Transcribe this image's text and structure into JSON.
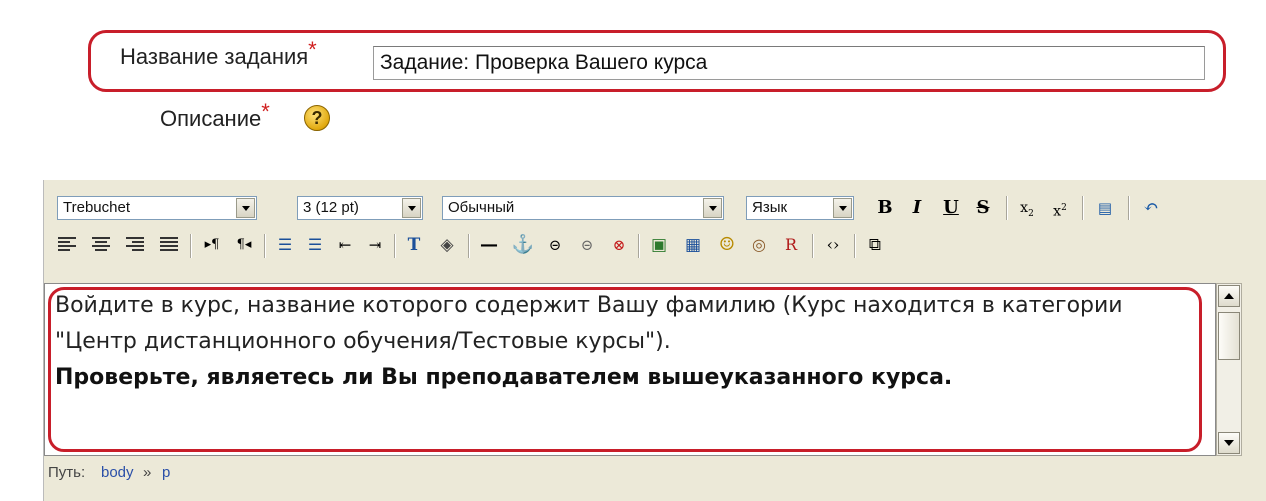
{
  "form": {
    "title_label": "Название задания",
    "title_required": "*",
    "title_value": "Задание: Проверка Вашего курса",
    "description_label": "Описание",
    "description_required": "*",
    "help_glyph": "?"
  },
  "toolbar": {
    "font_family": "Trebuchet",
    "font_size": "3 (12 pt)",
    "format": "Обычный",
    "language": "Язык",
    "row1_icons": [
      "bold-icon",
      "italic-icon",
      "underline-icon",
      "strikethrough-icon",
      "subscript-icon",
      "superscript-icon",
      "paste-word-icon",
      "undo-icon"
    ],
    "row2_icons": [
      "align-left-icon",
      "align-center-icon",
      "align-right-icon",
      "align-justify-icon",
      "ltr-icon",
      "rtl-icon",
      "ordered-list-icon",
      "unordered-list-icon",
      "outdent-icon",
      "indent-icon",
      "text-color-icon",
      "bg-color-icon",
      "horizontal-rule-icon",
      "anchor-icon",
      "link-icon",
      "unlink-icon",
      "nolink-icon",
      "image-icon",
      "table-icon",
      "smiley-icon",
      "special-char-icon",
      "search-replace-icon",
      "html-source-icon",
      "fullscreen-icon"
    ]
  },
  "content": {
    "paragraph1": "Войдите в курс, название которого содержит Вашу фамилию (Курс находится в категории \"Центр дистанционного обучения/Тестовые курсы\").",
    "paragraph2": "Проверьте, являетесь ли Вы преподавателем вышеуказанного курса."
  },
  "status_path": {
    "label": "Путь:",
    "items": [
      "body",
      "p"
    ],
    "separator": "»"
  },
  "colors": {
    "highlight": "#c81e2a",
    "editor_bg": "#ece9d8",
    "required_star": "#d02020"
  }
}
